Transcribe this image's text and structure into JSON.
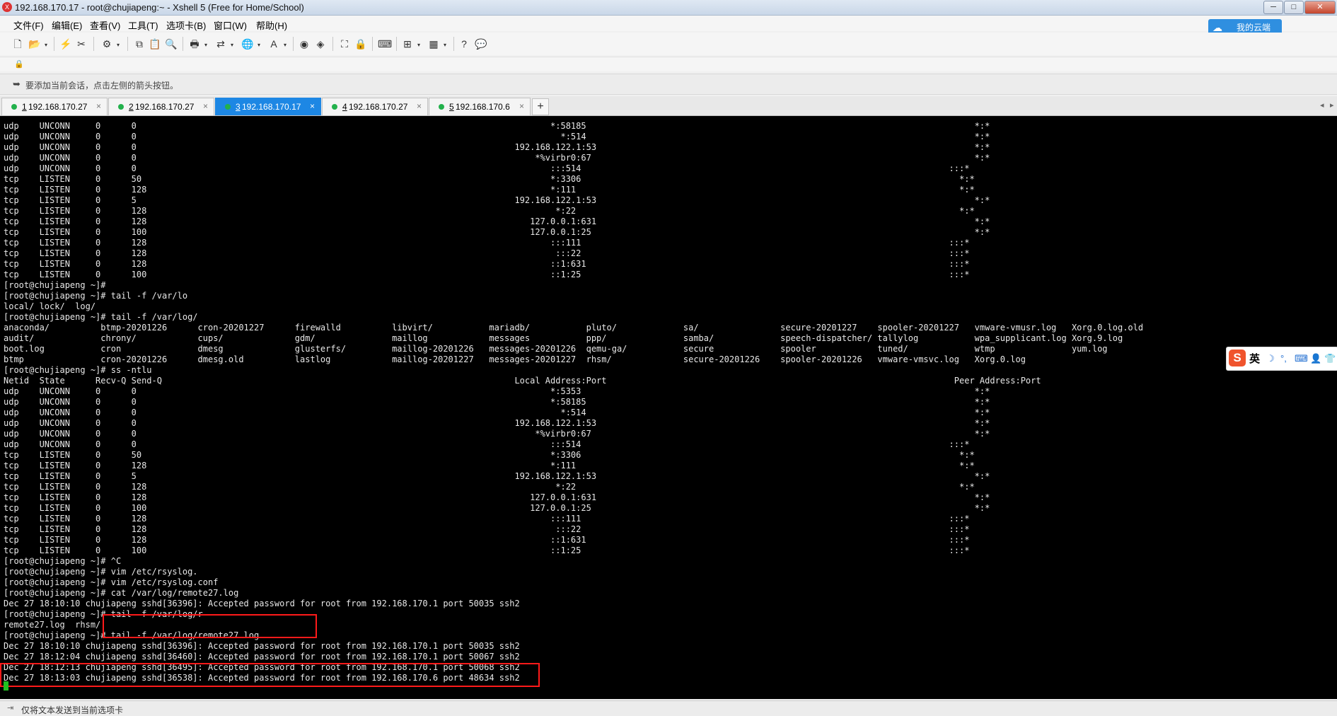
{
  "window": {
    "title": "192.168.170.17 - root@chujiapeng:~ - Xshell 5 (Free for Home/School)",
    "minimize": "─",
    "maximize": "□",
    "close": "✕"
  },
  "menu": {
    "items": [
      "文件(F)",
      "编辑(E)",
      "查看(V)",
      "工具(T)",
      "选项卡(B)",
      "窗口(W)",
      "帮助(H)"
    ]
  },
  "cloud_button": {
    "label": "我的云端"
  },
  "hint_bar": {
    "text": "要添加当前会话，点击左侧的箭头按钮。"
  },
  "tabs": [
    {
      "num": "1",
      "host": "192.168.170.27",
      "active": false
    },
    {
      "num": "2",
      "host": "192.168.170.27",
      "active": false
    },
    {
      "num": "3",
      "host": "192.168.170.17",
      "active": true
    },
    {
      "num": "4",
      "host": "192.168.170.27",
      "active": false
    },
    {
      "num": "5",
      "host": "192.168.170.6",
      "active": false
    }
  ],
  "tab_add": "+",
  "tab_close": "×",
  "terminal": {
    "lines": [
      "udp    UNCONN     0      0                                                                                 *:58185                                                                            *:*",
      "udp    UNCONN     0      0                                                                                   *:514                                                                            *:*",
      "udp    UNCONN     0      0                                                                          192.168.122.1:53                                                                          *:*",
      "udp    UNCONN     0      0                                                                              *%virbr0:67                                                                           *:*",
      "udp    UNCONN     0      0                                                                                 :::514                                                                        :::*",
      "tcp    LISTEN     0      50                                                                                *:3306                                                                          *:*",
      "tcp    LISTEN     0      128                                                                               *:111                                                                           *:*",
      "tcp    LISTEN     0      5                                                                          192.168.122.1:53                                                                          *:*",
      "tcp    LISTEN     0      128                                                                                *:22                                                                           *:*",
      "tcp    LISTEN     0      128                                                                           127.0.0.1:631                                                                          *:*",
      "tcp    LISTEN     0      100                                                                           127.0.0.1:25                                                                           *:*",
      "tcp    LISTEN     0      128                                                                               :::111                                                                        :::*",
      "tcp    LISTEN     0      128                                                                                :::22                                                                        :::*",
      "tcp    LISTEN     0      128                                                                               ::1:631                                                                       :::*",
      "tcp    LISTEN     0      100                                                                               ::1:25                                                                        :::*",
      "[root@chujiapeng ~]#",
      "[root@chujiapeng ~]# tail -f /var/lo",
      "local/ lock/  log/",
      "[root@chujiapeng ~]# tail -f /var/log/",
      "anaconda/          btmp-20201226      cron-20201227      firewalld          libvirt/           mariadb/           pluto/             sa/                secure-20201227    spooler-20201227   vmware-vmusr.log   Xorg.0.log.old",
      "audit/             chrony/            cups/              gdm/               maillog            messages           ppp/               samba/             speech-dispatcher/ tallylog           wpa_supplicant.log Xorg.9.log",
      "boot.log           cron               dmesg              glusterfs/         maillog-20201226   messages-20201226  qemu-ga/           secure             spooler            tuned/             wtmp               yum.log",
      "btmp               cron-20201226      dmesg.old          lastlog            maillog-20201227   messages-20201227  rhsm/              secure-20201226    spooler-20201226   vmware-vmsvc.log   Xorg.0.log",
      "[root@chujiapeng ~]# ss -ntlu",
      "Netid  State      Recv-Q Send-Q                                                                     Local Address:Port                                                                    Peer Address:Port",
      "udp    UNCONN     0      0                                                                                 *:5353                                                                             *:*",
      "udp    UNCONN     0      0                                                                                 *:58185                                                                            *:*",
      "udp    UNCONN     0      0                                                                                   *:514                                                                            *:*",
      "udp    UNCONN     0      0                                                                          192.168.122.1:53                                                                          *:*",
      "udp    UNCONN     0      0                                                                              *%virbr0:67                                                                           *:*",
      "udp    UNCONN     0      0                                                                                 :::514                                                                        :::*",
      "tcp    LISTEN     0      50                                                                                *:3306                                                                          *:*",
      "tcp    LISTEN     0      128                                                                               *:111                                                                           *:*",
      "tcp    LISTEN     0      5                                                                          192.168.122.1:53                                                                          *:*",
      "tcp    LISTEN     0      128                                                                                *:22                                                                           *:*",
      "tcp    LISTEN     0      128                                                                           127.0.0.1:631                                                                          *:*",
      "tcp    LISTEN     0      100                                                                           127.0.0.1:25                                                                           *:*",
      "tcp    LISTEN     0      128                                                                               :::111                                                                        :::*",
      "tcp    LISTEN     0      128                                                                                :::22                                                                        :::*",
      "tcp    LISTEN     0      128                                                                               ::1:631                                                                       :::*",
      "tcp    LISTEN     0      100                                                                               ::1:25                                                                        :::*",
      "[root@chujiapeng ~]# ^C",
      "[root@chujiapeng ~]# vim /etc/rsyslog.",
      "[root@chujiapeng ~]# vim /etc/rsyslog.conf",
      "[root@chujiapeng ~]# cat /var/log/remote27.log",
      "Dec 27 18:10:10 chujiapeng sshd[36396]: Accepted password for root from 192.168.170.1 port 50035 ssh2",
      "[root@chujiapeng ~]# tail -f /var/log/r",
      "remote27.log  rhsm/",
      "[root@chujiapeng ~]# tail -f /var/log/remote27.log",
      "Dec 27 18:10:10 chujiapeng sshd[36396]: Accepted password for root from 192.168.170.1 port 50035 ssh2",
      "Dec 27 18:12:04 chujiapeng sshd[36460]: Accepted password for root from 192.168.170.1 port 50067 ssh2",
      "Dec 27 18:12:13 chujiapeng sshd[36495]: Accepted password for root from 192.168.170.1 port 50068 ssh2",
      "Dec 27 18:13:03 chujiapeng sshd[36538]: Accepted password for root from 192.168.170.6 port 48634 ssh2"
    ]
  },
  "ime": {
    "logo": "S",
    "lang": "英"
  },
  "status_bar": {
    "text": "仅将文本发送到当前选项卡"
  },
  "colors": {
    "accent": "#1d87e4",
    "highlight": "#ff1a1a",
    "terminal_bg": "#000000",
    "terminal_fg": "#e8e8e8",
    "session_dot": "#22b14c"
  }
}
